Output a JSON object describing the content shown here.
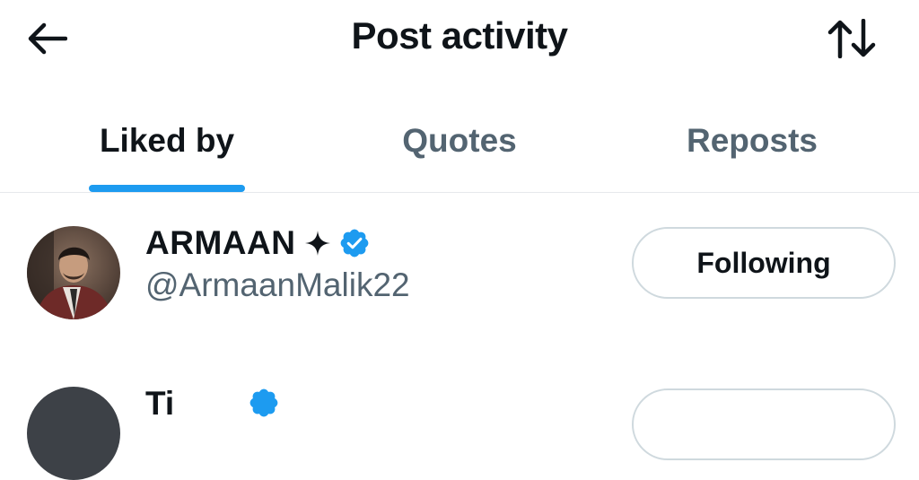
{
  "header": {
    "title": "Post activity",
    "back_icon": "arrow-left-icon",
    "sort_icon": "sort-arrows-icon"
  },
  "tabs": [
    {
      "label": "Liked by",
      "active": true
    },
    {
      "label": "Quotes",
      "active": false
    },
    {
      "label": "Reposts",
      "active": false
    }
  ],
  "users": [
    {
      "name": "ARMAAN",
      "badge_icon": "sparkle-icon",
      "verified": true,
      "handle": "@ArmaanMalik22",
      "follow_label": "Following"
    },
    {
      "name": "Ti",
      "verified": true
    }
  ],
  "colors": {
    "accent": "#1d9bf0",
    "text_primary": "#0f1419",
    "text_secondary": "#536471",
    "border": "#cfd9de"
  }
}
